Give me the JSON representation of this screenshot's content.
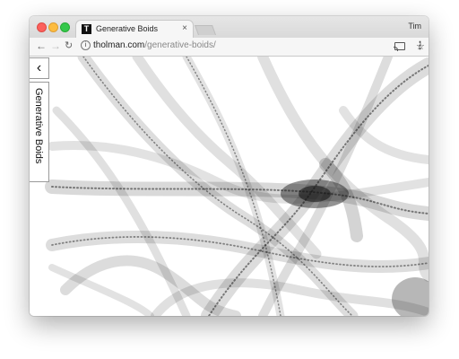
{
  "browser": {
    "tab_title": "Generative Boids",
    "tab_favicon": "T",
    "tab_close": "×",
    "profile_name": "Tim",
    "url_host": "tholman.com",
    "url_path": "/generative-boids/",
    "icons": {
      "back": "arrow-left-icon",
      "forward": "arrow-right-icon",
      "reload": "reload-icon",
      "info": "info-icon",
      "bookmark": "star-icon",
      "cast": "cast-icon",
      "menu": "menu-dots-icon"
    }
  },
  "page": {
    "back_label": "‹",
    "side_label": "Generative Boids"
  },
  "colors": {
    "traffic_close": "#fc605c",
    "traffic_min": "#fdbc40",
    "traffic_max": "#34c84a",
    "ink": "#111111"
  }
}
